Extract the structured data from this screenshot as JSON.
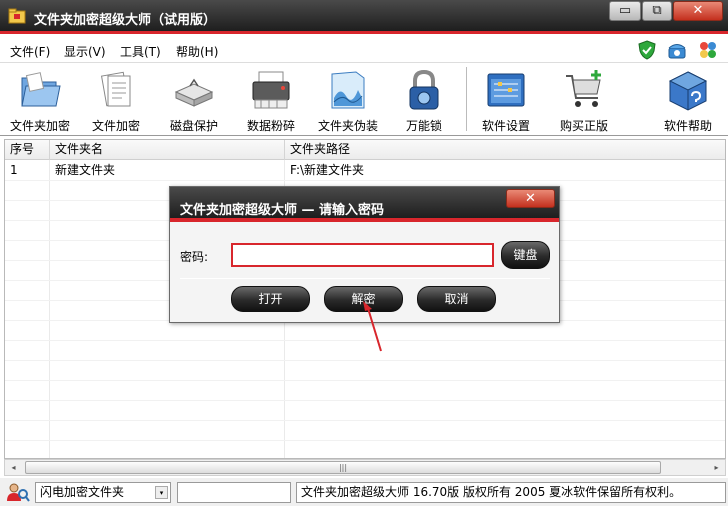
{
  "window": {
    "title": "文件夹加密超级大师（试用版）"
  },
  "window_buttons": {
    "minimize": "▭",
    "maximize": "⧉",
    "close": "✕"
  },
  "menu": [
    {
      "label": "文件(F)"
    },
    {
      "label": "显示(V)"
    },
    {
      "label": "工具(T)"
    },
    {
      "label": "帮助(H)"
    }
  ],
  "menu_icons": [
    "shield-check-icon",
    "telephone-icon",
    "puzzle-icon"
  ],
  "toolbar": [
    {
      "label": "文件夹加密",
      "icon": "folder-icon"
    },
    {
      "label": "文件加密",
      "icon": "document-icon"
    },
    {
      "label": "磁盘保护",
      "icon": "disk-drive-icon"
    },
    {
      "label": "数据粉碎",
      "icon": "shredder-icon"
    },
    {
      "label": "文件夹伪装",
      "icon": "folder-disguise-icon"
    },
    {
      "label": "万能锁",
      "icon": "padlock-icon"
    },
    {
      "label": "软件设置",
      "icon": "settings-window-icon"
    },
    {
      "label": "购买正版",
      "icon": "shopping-cart-icon"
    },
    {
      "label": "软件帮助",
      "icon": "help-cube-icon"
    }
  ],
  "table": {
    "columns": [
      "序号",
      "文件夹名",
      "文件夹路径"
    ],
    "rows": [
      [
        "1",
        "新建文件夹",
        "F:\\新建文件夹"
      ]
    ]
  },
  "scrollbar": {
    "left": "◂",
    "right": "▸",
    "grip": "|||"
  },
  "status": {
    "mode": "闪电加密文件夹",
    "dropdown_arrow": "▾",
    "middle": "",
    "info": "文件夹加密超级大师 16.70版 版权所有 2005 夏冰软件保留所有权利。"
  },
  "dialog": {
    "title": "文件夹加密超级大师 — 请输入密码",
    "close": "✕",
    "password_label": "密码:",
    "password_value": "",
    "keyboard_button": "键盘",
    "open_button": "打开",
    "decrypt_button": "解密",
    "cancel_button": "取消"
  },
  "colors": {
    "accent_red": "#d8262c",
    "titlebar_dark": "#2a2a2a"
  }
}
